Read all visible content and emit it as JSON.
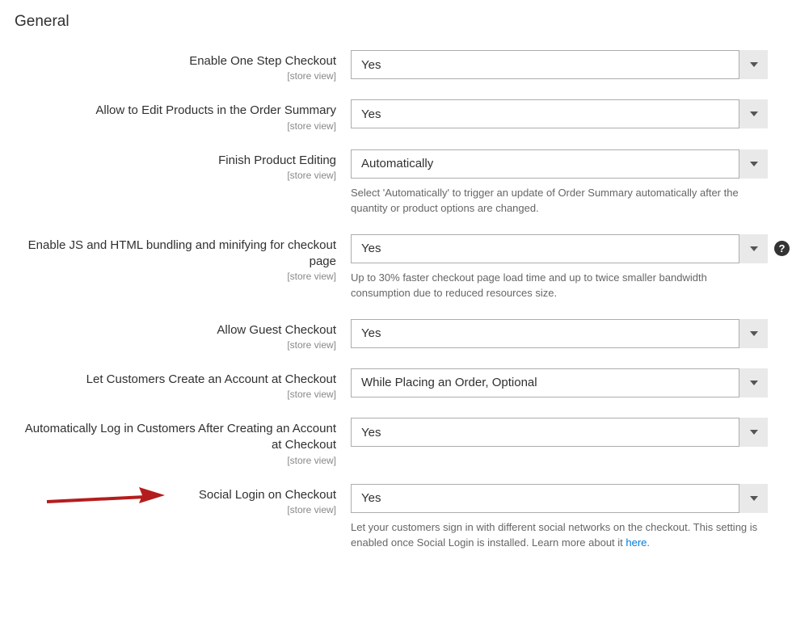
{
  "section_title": "General",
  "scope_label": "[store view]",
  "fields": {
    "enable_osc": {
      "label": "Enable One Step Checkout",
      "value": "Yes"
    },
    "allow_edit": {
      "label": "Allow to Edit Products in the Order Summary",
      "value": "Yes"
    },
    "finish_edit": {
      "label": "Finish Product Editing",
      "value": "Automatically",
      "note": "Select 'Automatically' to trigger an update of Order Summary automatically after the quantity or product options are changed."
    },
    "bundling": {
      "label": "Enable JS and HTML bundling and minifying for checkout page",
      "value": "Yes",
      "note": "Up to 30% faster checkout page load time and up to twice smaller bandwidth consumption due to reduced resources size."
    },
    "guest_checkout": {
      "label": "Allow Guest Checkout",
      "value": "Yes"
    },
    "create_account": {
      "label": "Let Customers Create an Account at Checkout",
      "value": "While Placing an Order, Optional"
    },
    "auto_login": {
      "label": "Automatically Log in Customers After Creating an Account at Checkout",
      "value": "Yes"
    },
    "social_login": {
      "label": "Social Login on Checkout",
      "value": "Yes",
      "note_prefix": "Let your customers sign in with different social networks on the checkout. This setting is enabled once Social Login is installed. Learn more about it ",
      "note_link": "here",
      "note_suffix": "."
    }
  }
}
